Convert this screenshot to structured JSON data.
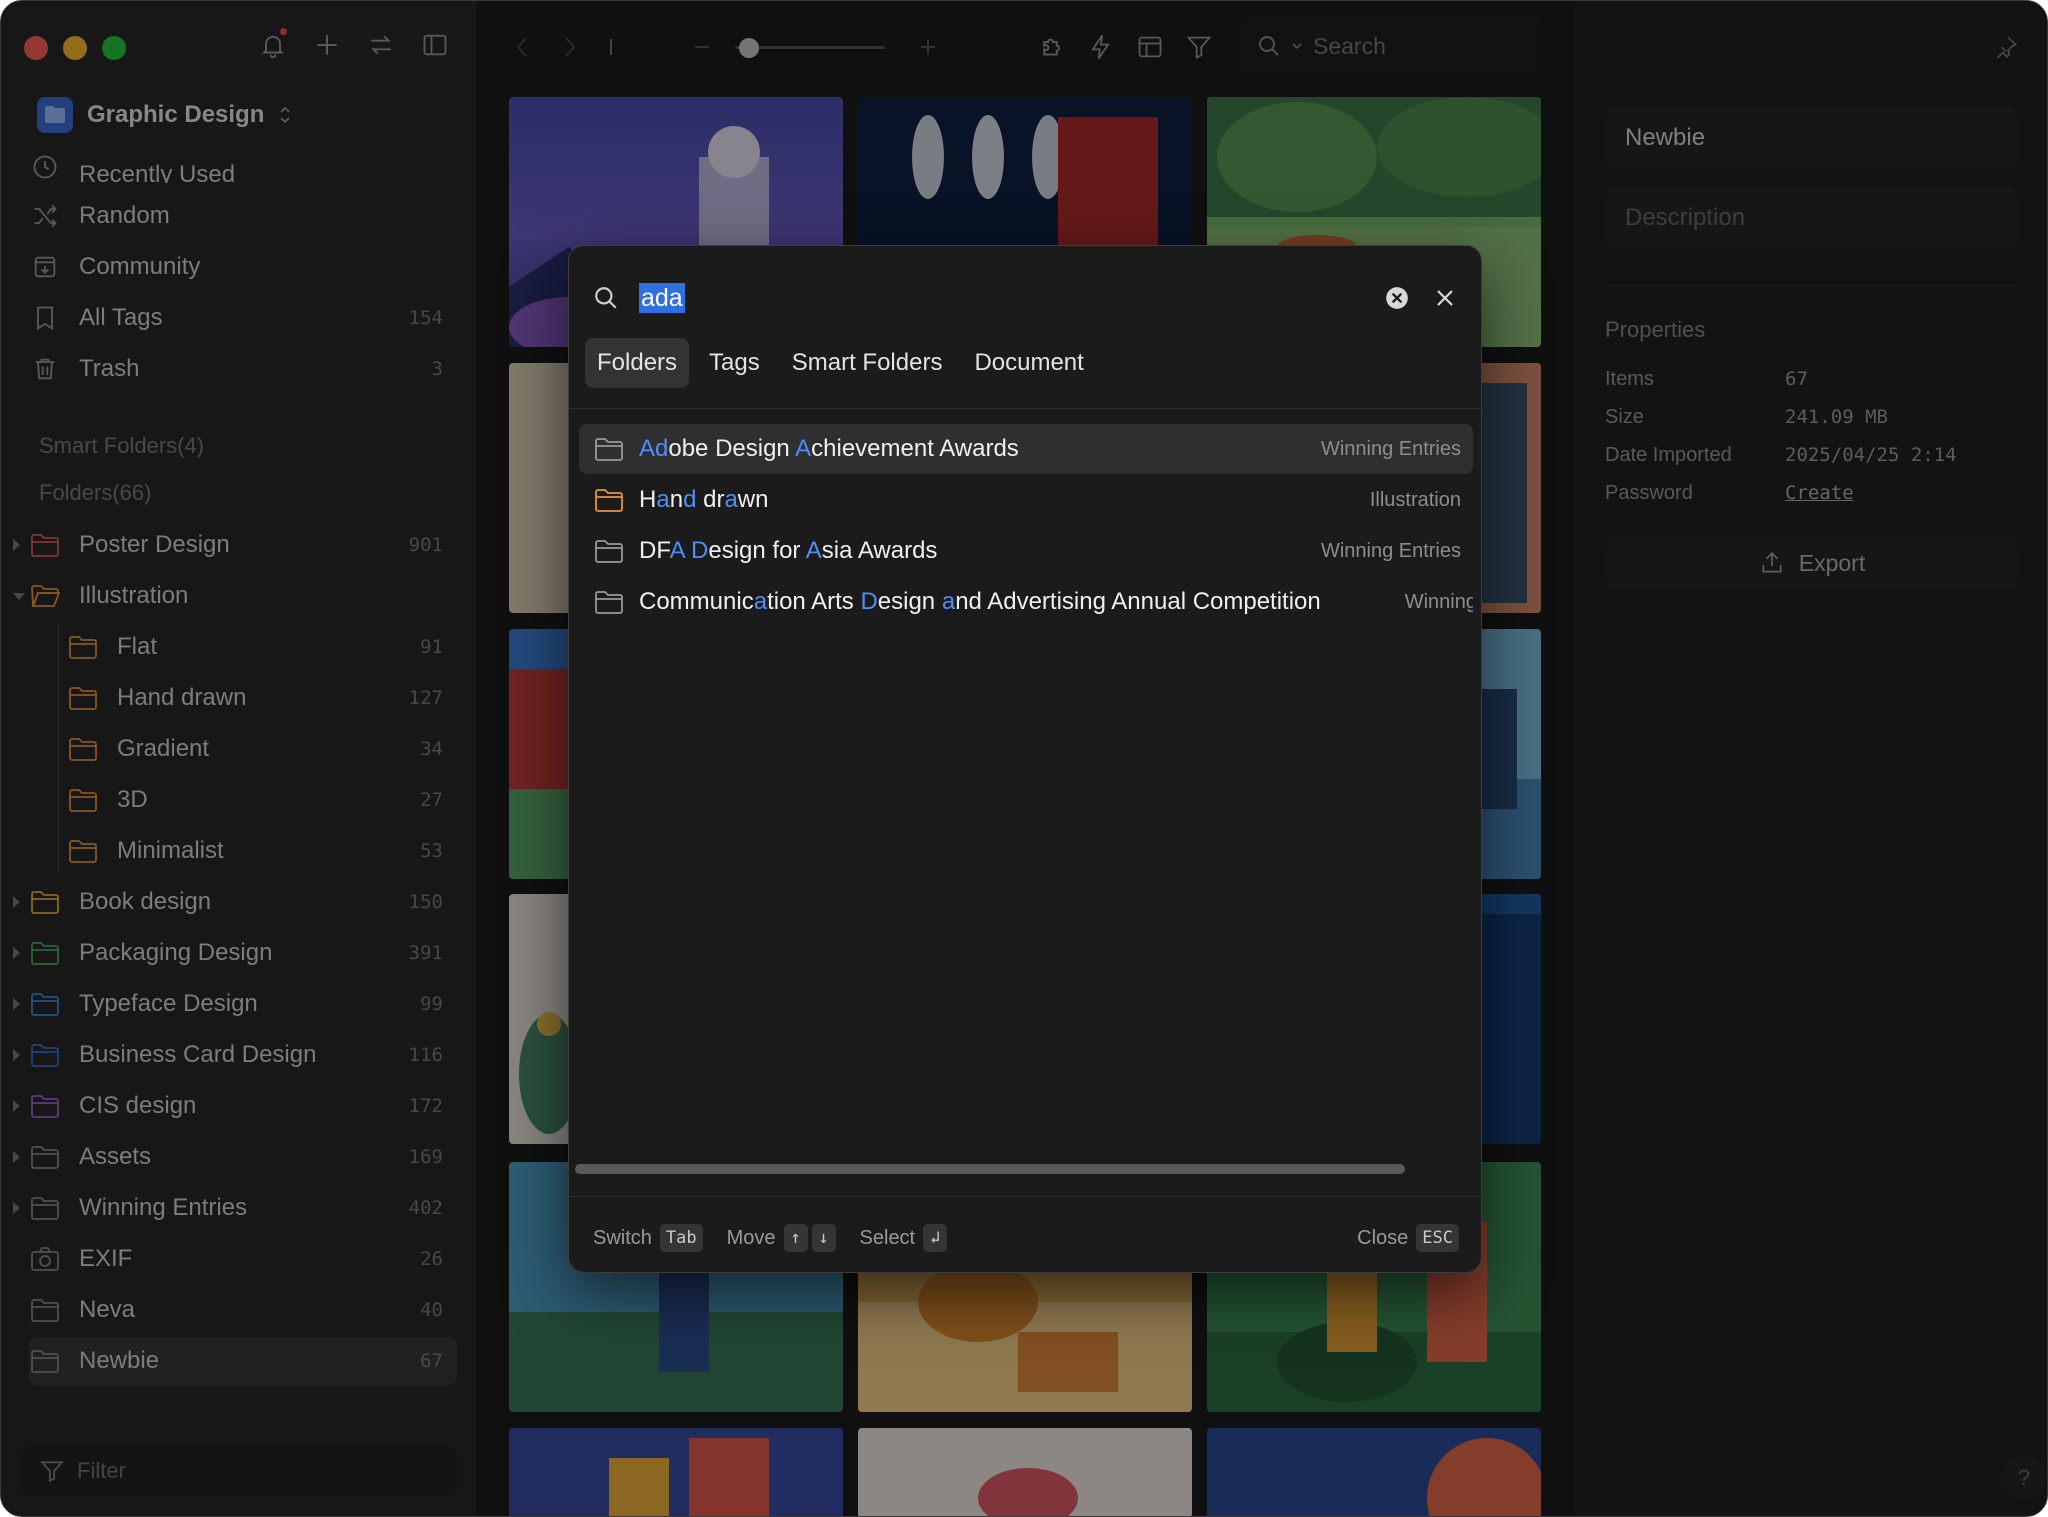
{
  "sidebar": {
    "library_name": "Graphic Design",
    "nav": [
      {
        "label": "Recently Used",
        "count": ""
      },
      {
        "label": "Random",
        "count": ""
      },
      {
        "label": "Community",
        "count": ""
      },
      {
        "label": "All Tags",
        "count": "154"
      },
      {
        "label": "Trash",
        "count": "3"
      }
    ],
    "smart_folders_heading": "Smart Folders(4)",
    "folders_heading": "Folders(66)",
    "folders": [
      {
        "label": "Poster Design",
        "count": "901",
        "color": "#e35d5d"
      },
      {
        "label": "Illustration",
        "count": "",
        "color": "#e8943a"
      },
      {
        "label": "Flat",
        "count": "91",
        "color": "#e8943a"
      },
      {
        "label": "Hand drawn",
        "count": "127",
        "color": "#e8943a"
      },
      {
        "label": "Gradient",
        "count": "34",
        "color": "#e8943a"
      },
      {
        "label": "3D",
        "count": "27",
        "color": "#e8943a"
      },
      {
        "label": "Minimalist",
        "count": "53",
        "color": "#e8943a"
      },
      {
        "label": "Book design",
        "count": "150",
        "color": "#e8b33a"
      },
      {
        "label": "Packaging Design",
        "count": "391",
        "color": "#4cae5a"
      },
      {
        "label": "Typeface Design",
        "count": "99",
        "color": "#3a8fd6"
      },
      {
        "label": "Business Card Design",
        "count": "116",
        "color": "#3a74d6"
      },
      {
        "label": "CIS design",
        "count": "172",
        "color": "#9b6ad6"
      },
      {
        "label": "Assets",
        "count": "169",
        "color": "#8a8a8a"
      },
      {
        "label": "Winning Entries",
        "count": "402",
        "color": "#8a8a8a"
      },
      {
        "label": "EXIF",
        "count": "26",
        "color": "#8a8a8a"
      },
      {
        "label": "Neva",
        "count": "40",
        "color": "#8a8a8a"
      },
      {
        "label": "Newbie",
        "count": "67",
        "color": "#8a8a8a"
      }
    ],
    "filter_placeholder": "Filter"
  },
  "toolbar": {
    "search_placeholder": "Search"
  },
  "inspector": {
    "title": "Newbie",
    "description_placeholder": "Description",
    "properties_heading": "Properties",
    "properties": [
      {
        "key": "Items",
        "value": "67"
      },
      {
        "key": "Size",
        "value": "241.09 MB"
      },
      {
        "key": "Date Imported",
        "value": "2025/04/25 2:14"
      },
      {
        "key": "Password",
        "value": "Create"
      }
    ],
    "export_label": "Export",
    "help_label": "?"
  },
  "modal": {
    "query": "ada",
    "tabs": [
      "Folders",
      "Tags",
      "Smart Folders",
      "Document"
    ],
    "active_tab": "Folders",
    "results": [
      {
        "segments": [
          {
            "t": "Ad",
            "hl": true
          },
          {
            "t": "obe Design ",
            "hl": false
          },
          {
            "t": "A",
            "hl": true
          },
          {
            "t": "chievement Awards",
            "hl": false
          }
        ],
        "parent": "Winning Entries",
        "icon_color": "#9a9a9a",
        "selected": true
      },
      {
        "segments": [
          {
            "t": "H",
            "hl": false
          },
          {
            "t": "a",
            "hl": true
          },
          {
            "t": "n",
            "hl": false
          },
          {
            "t": "d",
            "hl": true
          },
          {
            "t": " dr",
            "hl": false
          },
          {
            "t": "a",
            "hl": true
          },
          {
            "t": "wn",
            "hl": false
          }
        ],
        "parent": "Illustration",
        "icon_color": "#e8943a",
        "selected": false
      },
      {
        "segments": [
          {
            "t": "DF",
            "hl": false
          },
          {
            "t": "A",
            "hl": true
          },
          {
            "t": " ",
            "hl": false
          },
          {
            "t": "D",
            "hl": true
          },
          {
            "t": "esign for ",
            "hl": false
          },
          {
            "t": "A",
            "hl": true
          },
          {
            "t": "sia Awards",
            "hl": false
          }
        ],
        "parent": "Winning Entries",
        "icon_color": "#9a9a9a",
        "selected": false
      },
      {
        "segments": [
          {
            "t": "Communic",
            "hl": false
          },
          {
            "t": "a",
            "hl": true
          },
          {
            "t": "tion Arts ",
            "hl": false
          },
          {
            "t": "D",
            "hl": true
          },
          {
            "t": "esign ",
            "hl": false
          },
          {
            "t": "a",
            "hl": true
          },
          {
            "t": "nd Advertising Annual Competition",
            "hl": false
          }
        ],
        "parent": "Winning",
        "icon_color": "#9a9a9a",
        "selected": false
      }
    ],
    "footer": {
      "switch_label": "Switch",
      "switch_key": "Tab",
      "move_label": "Move",
      "move_up_key": "↑",
      "move_down_key": "↓",
      "select_label": "Select",
      "select_key": "↲",
      "close_label": "Close",
      "close_key": "ESC"
    }
  }
}
